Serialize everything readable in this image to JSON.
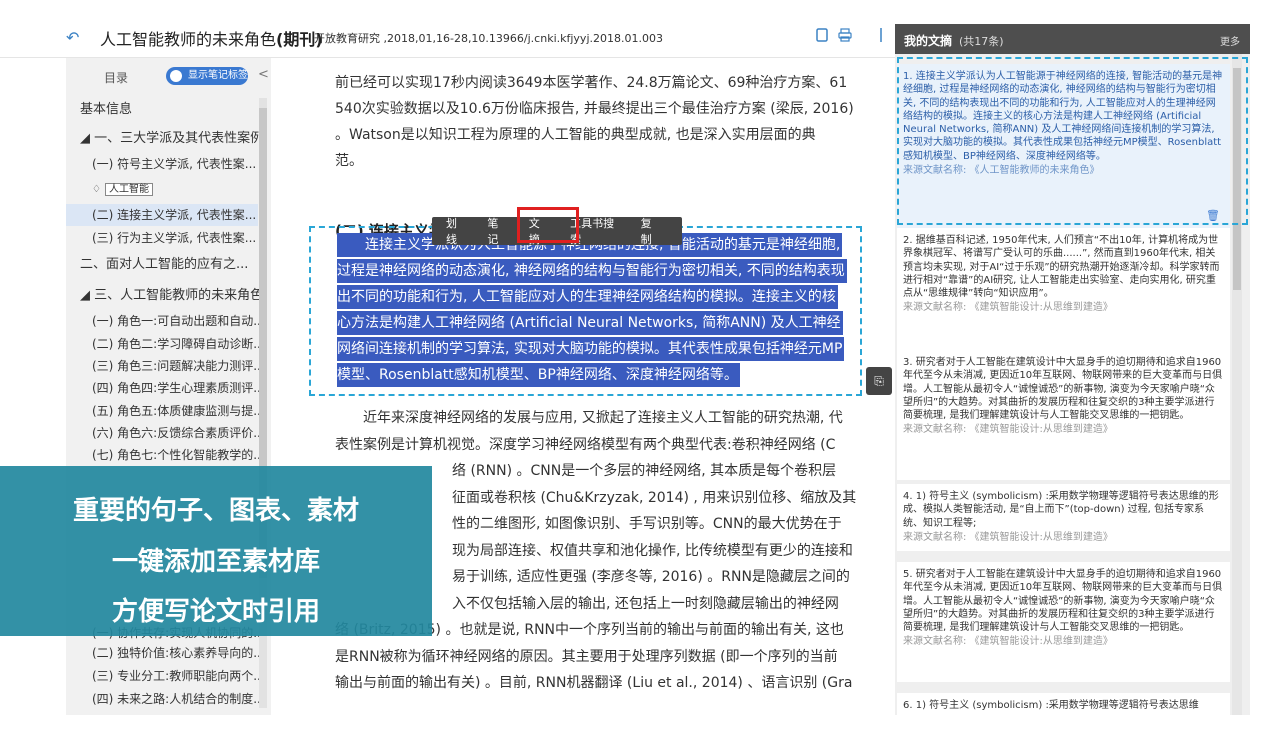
{
  "topbar": {
    "title": "人工智能教师的未来角色",
    "title_tag": "(期刊)",
    "meta": "开放教育研究 ,2018,01,16-28,10.13966/j.cnki.kfjyyj.2018.01.003"
  },
  "toc": {
    "label": "目录",
    "toggle_label": "显示笔记标签",
    "items": [
      "基本信息",
      "一、三大学派及其代表性案例",
      "(一) 符号主义学派, 代表性案...",
      "人工智能",
      "(二) 连接主义学派, 代表性案...",
      "(三) 行为主义学派, 代表性案...",
      "二、面对人工智能的应有之...",
      "三、人工智能教师的未来角色",
      "(一) 角色一:可自动出题和自动...",
      "(二) 角色二:学习障碍自动诊断...",
      "(三) 角色三:问题解决能力测评...",
      "(四) 角色四:学生心理素质测评...",
      "(五) 角色五:体质健康监测与提...",
      "(六) 角色六:反馈综合素质评价...",
      "(七) 角色七:个性化智能教学的...",
      "(一) 协作共存:实现人机协同的...",
      "(二) 独特价值:核心素养导向的...",
      "(三) 专业分工:教师职能向两个...",
      "(四) 未来之路:人机结合的制度..."
    ]
  },
  "main": {
    "p1": [
      "前已经可以实现17秒内阅读3649本医学著作、24.8万篇论文、69种治疗方案、61",
      "540次实验数据以及10.6万份临床报告, 并最终提出三个最佳治疗方案 (梁辰, 2016)",
      "。Watson是以知识工程为原理的人工智能的典型成就, 也是深入实用层面的典",
      "范。"
    ],
    "section_title": "(二) 连接主义学",
    "popup": [
      "划线",
      "笔记",
      "文摘",
      "工具书搜索",
      "复制"
    ],
    "highlight": [
      "　　连接主义学派认为人工智能源于神经网络的连接, 智能活动的基元是神经细胞,",
      "过程是神经网络的动态演化, 神经网络的结构与智能行为密切相关, 不同的结构表现",
      "出不同的功能和行为, 人工智能应对人的生理神经网络结构的模拟。连接主义的核",
      "心方法是构建人工神经网络 (Artificial Neural Networks, 简称ANN) 及人工神经",
      "网络间连接机制的学习算法, 实现对大脑功能的模拟。其代表性成果包括神经元MP",
      "模型、Rosenblatt感知机模型、BP神经网络、深度神经网络等。"
    ],
    "p2": [
      "　　近年来深度神经网络的发展与应用, 又掀起了连接主义人工智能的研究热潮, 代",
      "表性案例是计算机视觉。深度学习神经网络模型有两个典型代表:卷积神经网络 (C",
      "络 (RNN) 。CNN是一个多层的神经网络, 其本质是每个卷积层",
      "征面或卷积核 (Chu&Krzyzak, 2014) , 用来识别位移、缩放及其",
      "性的二维图形, 如图像识别、手写识别等。CNN的最大优势在于",
      "现为局部连接、权值共享和池化操作, 比传统模型有更少的连接和",
      "易于训练, 适应性更强 (李彦冬等, 2016) 。RNN是隐藏层之间的",
      "入不仅包括输入层的输出, 还包括上一时刻隐藏层输出的神经网",
      "络 (Britz, 2015) 。也就是说, RNN中一个序列当前的输出与前面的输出有关, 这也",
      "是RNN被称为循环神经网络的原因。其主要用于处理序列数据 (即一个序列的当前",
      "输出与前面的输出有关) 。目前, RNN机器翻译 (Liu et al., 2014) 、语言识别 (Gra"
    ]
  },
  "banner": {
    "line1": "重要的句子、图表、素材",
    "line2": "一键添加至素材库",
    "line3": "方便写论文时引用"
  },
  "rpanel": {
    "title": "我的文摘",
    "count": "(共17条)",
    "more": "更多",
    "source_label": "来源文献名称:",
    "cards": [
      {
        "text": "1. 连接主义学派认为人工智能源于神经网络的连接, 智能活动的基元是神经细胞, 过程是神经网络的动态演化, 神经网络的结构与智能行为密切相关, 不同的结构表现出不同的功能和行为, 人工智能应对人的生理神经网络结构的模拟。连接主义的核心方法是构建人工神经网络 (Artificial Neural Networks, 简称ANN) 及人工神经网络间连接机制的学习算法, 实现对大脑功能的模拟。其代表性成果包括神经元MP模型、Rosenblatt感知机模型、BP神经网络、深度神经网络等。",
        "source": "来源文献名称: 《人工智能教师的未来角色》"
      },
      {
        "text": "2. 据维基百科记述, 1950年代末, 人们预言“不出10年, 计算机将成为世界象棋冠军、将谱写广受认可的乐曲......”, 然而直到1960年代末, 相关预言均未实现, 对于AI“过于乐观”的研究热潮开始逐渐冷却。科学家转而进行相对“靠谱”的AI研究, 让人工智能走出实验室、走向实用化, 研究重点从“思维规律”转向“知识应用”。",
        "source": "来源文献名称: 《建筑智能设计:从思维到建造》"
      },
      {
        "text": "3. 研究者对于人工智能在建筑设计中大显身手的迫切期待和追求自1960年代至今从未消减, 更因近10年互联网、物联网带来的巨大变革而与日俱增。人工智能从最初令人“诚惶诚恐”的新事物, 演变为今天家喻户晓“众望所归”的大趋势。对其曲折的发展历程和往复交织的3种主要学派进行简要梳理, 是我们理解建筑设计与人工智能交叉思维的一把钥匙。",
        "source": "来源文献名称: 《建筑智能设计:从思维到建造》"
      },
      {
        "text": "4. 1) 符号主义 (symbolicism) :采用数学物理等逻辑符号表达思维的形成、模拟人类智能活动, 是“自上而下”(top-down) 过程, 包括专家系统、知识工程等;",
        "source": "来源文献名称: 《建筑智能设计:从思维到建造》"
      },
      {
        "text": "5. 研究者对于人工智能在建筑设计中大显身手的迫切期待和追求自1960年代至今从未消减, 更因近10年互联网、物联网带来的巨大变革而与日俱增。人工智能从最初令人“诚惶诚恐”的新事物, 演变为今天家喻户晓“众望所归”的大趋势。对其曲折的发展历程和往复交织的3种主要学派进行简要梳理, 是我们理解建筑设计与人工智能交叉思维的一把钥匙。",
        "source": "来源文献名称: 《建筑智能设计:从思维到建造》"
      },
      {
        "text": "6. 1) 符号主义 (symbolicism) :采用数学物理等逻辑符号表达思维",
        "source": ""
      }
    ]
  }
}
